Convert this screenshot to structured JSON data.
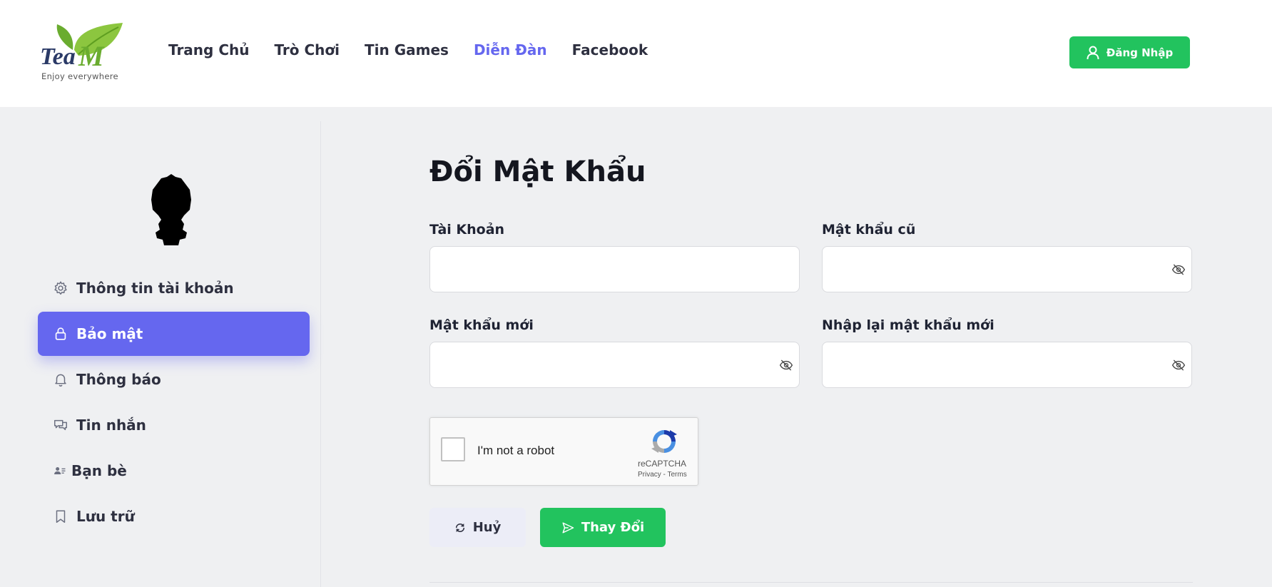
{
  "header": {
    "logo_text": "TeaM",
    "logo_tagline": "Enjoy everywhere",
    "nav": [
      {
        "label": "Trang Chủ",
        "active": false
      },
      {
        "label": "Trò Chơi",
        "active": false
      },
      {
        "label": "Tin Games",
        "active": false
      },
      {
        "label": "Diễn Đàn",
        "active": true
      },
      {
        "label": "Facebook",
        "active": false
      }
    ],
    "login_label": "Đăng Nhập"
  },
  "sidebar": {
    "items": [
      {
        "label": "Thông tin tài khoản",
        "icon": "gear-icon",
        "active": false
      },
      {
        "label": "Bảo mật",
        "icon": "lock-icon",
        "active": true
      },
      {
        "label": "Thông báo",
        "icon": "bell-icon",
        "active": false
      },
      {
        "label": "Tin nhắn",
        "icon": "chat-icon",
        "active": false
      },
      {
        "label": "Bạn bè",
        "icon": "friends-icon",
        "active": false
      },
      {
        "label": "Lưu trữ",
        "icon": "bookmark-icon",
        "active": false
      }
    ]
  },
  "form": {
    "title": "Đổi Mật Khẩu",
    "account_label": "Tài Khoản",
    "account_value": "",
    "old_password_label": "Mật khẩu cũ",
    "old_password_value": "",
    "new_password_label": "Mật khẩu mới",
    "new_password_value": "",
    "confirm_password_label": "Nhập lại mật khẩu mới",
    "confirm_password_value": "",
    "captcha_text": "I'm not a robot",
    "captcha_brand": "reCAPTCHA",
    "captcha_links": "Privacy - Terms",
    "cancel_label": "Huỷ",
    "submit_label": "Thay Đổi"
  },
  "colors": {
    "accent": "#6567ef",
    "success": "#22c35e",
    "background": "#eff0f2"
  }
}
